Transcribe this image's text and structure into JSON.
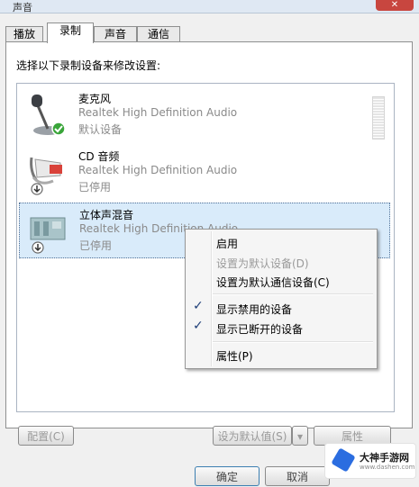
{
  "window": {
    "title": "声音",
    "close_label": "✕"
  },
  "tabs": [
    {
      "label": "播放"
    },
    {
      "label": "录制"
    },
    {
      "label": "声音"
    },
    {
      "label": "通信"
    }
  ],
  "instruction": "选择以下录制设备来修改设置:",
  "devices": [
    {
      "name": "麦克风",
      "driver": "Realtek High Definition Audio",
      "status": "默认设备",
      "icon": "microphone-icon"
    },
    {
      "name": "CD 音频",
      "driver": "Realtek High Definition Audio",
      "status": "已停用",
      "icon": "cd-audio-cable-icon"
    },
    {
      "name": "立体声混音",
      "driver": "Realtek High Definition Audio",
      "status": "已停用",
      "icon": "stereo-mix-card-icon"
    }
  ],
  "context_menu": {
    "items": [
      {
        "label": "启用",
        "enabled": true,
        "checked": false
      },
      {
        "label": "设置为默认设备(D)",
        "enabled": false,
        "checked": false
      },
      {
        "label": "设置为默认通信设备(C)",
        "enabled": true,
        "checked": false
      },
      {
        "label": "显示禁用的设备",
        "enabled": true,
        "checked": true
      },
      {
        "label": "显示已断开的设备",
        "enabled": true,
        "checked": true
      },
      {
        "label": "属性(P)",
        "enabled": true,
        "checked": false
      }
    ]
  },
  "buttons": {
    "configure": "配置(C)",
    "set_default": "设为默认值(S)",
    "properties": "属性",
    "ok": "确定",
    "cancel": "取消"
  },
  "watermark": {
    "name": "大神手游网",
    "url": "www.dashen.com"
  },
  "colors": {
    "selection": "#d9ebfa",
    "check": "#1f3f78",
    "default_badge": "#3aa53a"
  }
}
